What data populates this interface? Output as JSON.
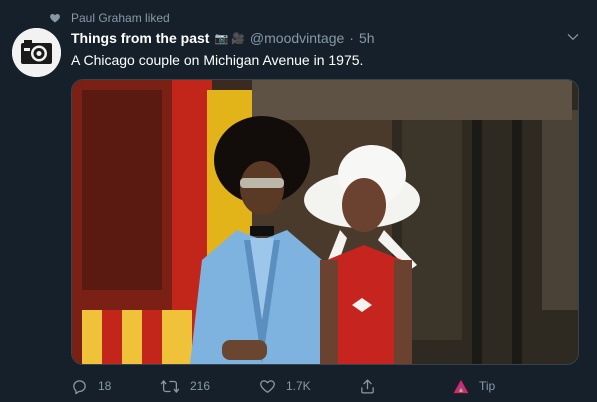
{
  "social_context": {
    "icon": "heart-icon",
    "text": "Paul Graham liked"
  },
  "tweet": {
    "display_name": "Things from the past",
    "name_emoji": "📷 🎥",
    "handle": "@moodvintage",
    "separator": "·",
    "timestamp": "5h",
    "text": "A Chicago couple on Michigan Avenue in 1975.",
    "avatar_icon": "camera-icon"
  },
  "actions": {
    "reply": {
      "icon": "reply-icon",
      "count": "18"
    },
    "retweet": {
      "icon": "retweet-icon",
      "count": "216"
    },
    "like": {
      "icon": "heart-icon",
      "count": "1.7K"
    },
    "share": {
      "icon": "share-icon"
    },
    "tip": {
      "icon": "tip-icon",
      "label": "Tip"
    }
  },
  "colors": {
    "background": "#15202b",
    "muted_text": "#8899a6",
    "text": "#ffffff"
  }
}
